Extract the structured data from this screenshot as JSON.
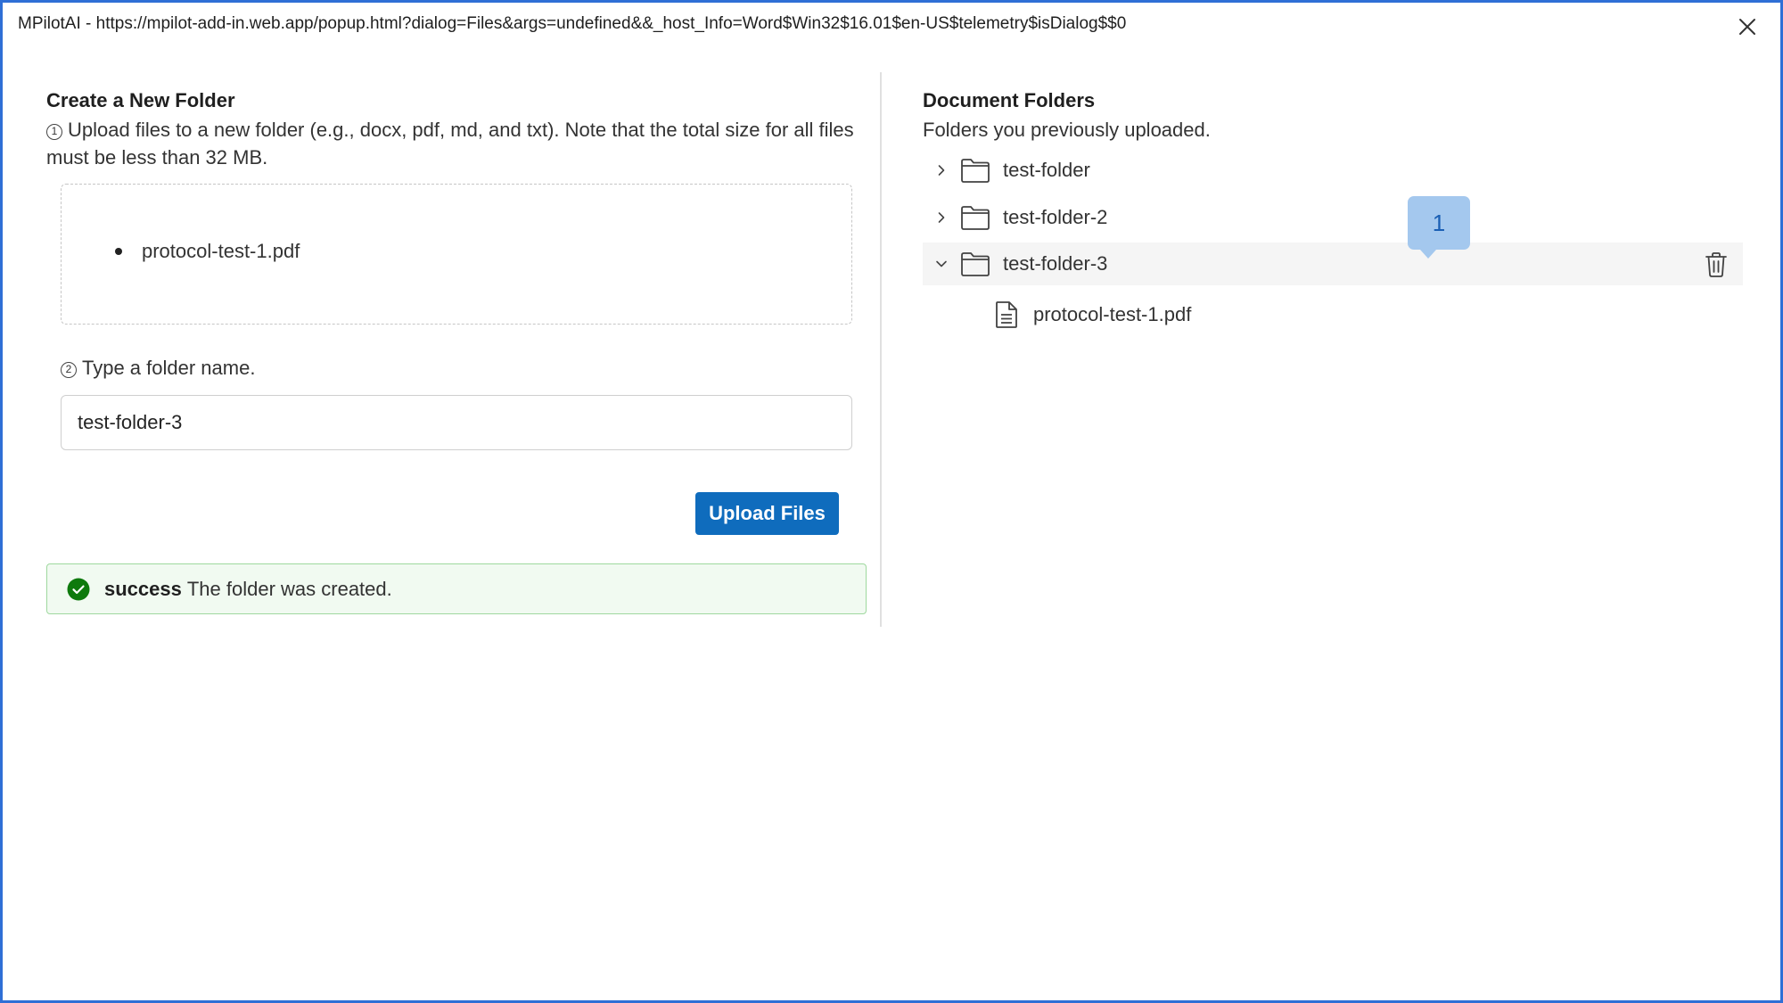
{
  "window": {
    "title": "MPilotAI - https://mpilot-add-in.web.app/popup.html?dialog=Files&args=undefined&&_host_Info=Word$Win32$16.01$en-US$telemetry$isDialog$$0",
    "accent_color": "#2f6fd6"
  },
  "create": {
    "title": "Create a New Folder",
    "step1_number": "1",
    "step1_text": "Upload files to a new folder (e.g., docx, pdf, md, and txt). Note that the total size for all files must be less than 32 MB.",
    "files": [
      "protocol-test-1.pdf"
    ],
    "step2_number": "2",
    "step2_text": "Type a folder name.",
    "folder_name_value": "test-folder-3",
    "upload_label": "Upload Files",
    "button_color": "#0f6cbd",
    "success_label": "success",
    "success_text": "The folder was created."
  },
  "folders": {
    "title": "Document Folders",
    "subtitle": "Folders you previously uploaded.",
    "items": [
      {
        "name": "test-folder",
        "expanded": false
      },
      {
        "name": "test-folder-2",
        "expanded": false
      },
      {
        "name": "test-folder-3",
        "expanded": true,
        "files": [
          "protocol-test-1.pdf"
        ]
      }
    ]
  },
  "badge": {
    "label": "1",
    "color": "#a4c8ee"
  },
  "icons": {
    "close": "close-icon",
    "chevron_right": "chevron-right-icon",
    "chevron_down": "chevron-down-icon",
    "folder": "folder-icon",
    "file": "document-icon",
    "delete": "trash-icon",
    "success": "checkmark-circle-icon"
  }
}
